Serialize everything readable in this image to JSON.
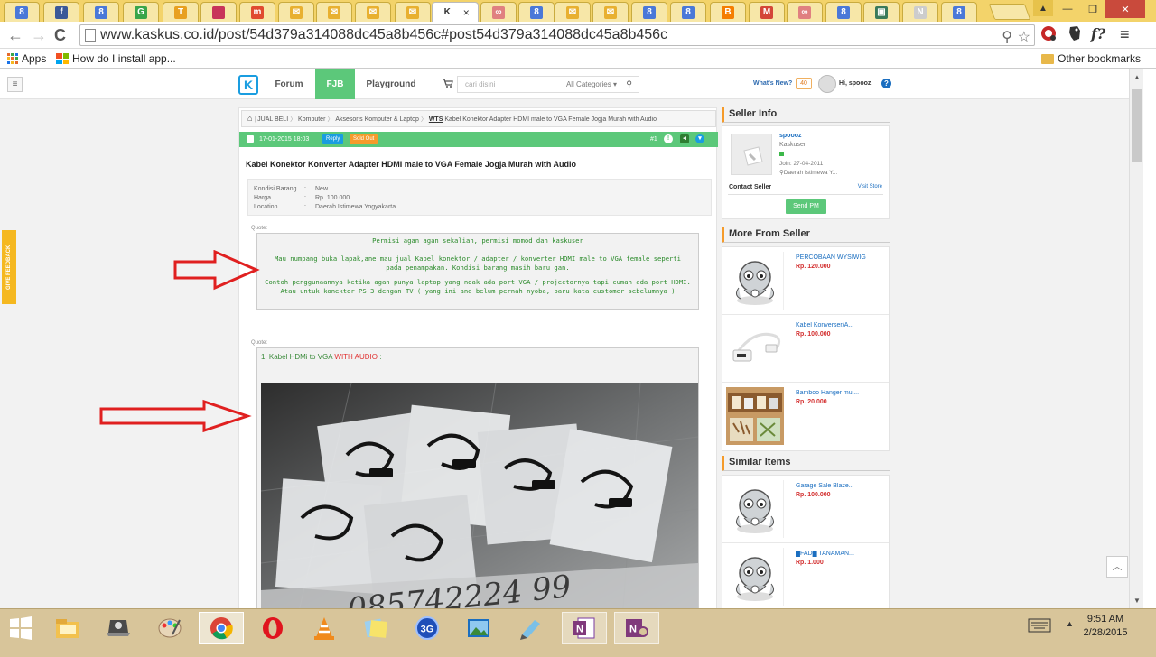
{
  "browser": {
    "tabs": [
      {
        "icon": "google-icon",
        "letter": "8",
        "color": "#4a78d8"
      },
      {
        "icon": "facebook-icon",
        "letter": "f",
        "color": "#3b5998"
      },
      {
        "icon": "google-icon",
        "letter": "8",
        "color": "#4a78d8"
      },
      {
        "icon": "g-green-icon",
        "letter": "G",
        "color": "#3aa54a"
      },
      {
        "icon": "t-icon",
        "letter": "T",
        "color": "#e8a020"
      },
      {
        "icon": "windows-icon",
        "letter": "",
        "color": "#c8345a"
      },
      {
        "icon": "m-icon",
        "letter": "m",
        "color": "#e04b30"
      },
      {
        "icon": "mail-icon",
        "letter": "✉",
        "color": "#e8b030"
      },
      {
        "icon": "mail-icon",
        "letter": "✉",
        "color": "#e8b030"
      },
      {
        "icon": "mail-icon",
        "letter": "✉",
        "color": "#e8b030"
      },
      {
        "icon": "mail-icon",
        "letter": "✉",
        "color": "#e8b030"
      },
      {
        "icon": "kaskus-icon",
        "letter": "K",
        "color": "#333333",
        "label": "K",
        "close": "×"
      },
      {
        "icon": "chain-icon",
        "letter": "∞",
        "color": "#e08080"
      },
      {
        "icon": "google-icon",
        "letter": "8",
        "color": "#4a78d8"
      },
      {
        "icon": "mail-icon",
        "letter": "✉",
        "color": "#e8b030"
      },
      {
        "icon": "mail-icon",
        "letter": "✉",
        "color": "#e8b030"
      },
      {
        "icon": "google-icon",
        "letter": "8",
        "color": "#4a78d8"
      },
      {
        "icon": "google-icon",
        "letter": "8",
        "color": "#4a78d8"
      },
      {
        "icon": "blogger-icon",
        "letter": "B",
        "color": "#f57d00"
      },
      {
        "icon": "gmail-icon",
        "letter": "M",
        "color": "#d44638"
      },
      {
        "icon": "chain-icon",
        "letter": "∞",
        "color": "#e08080"
      },
      {
        "icon": "google-icon",
        "letter": "8",
        "color": "#4a78d8"
      },
      {
        "icon": "landscape-icon",
        "letter": "▣",
        "color": "#3a7a5a"
      },
      {
        "icon": "n-icon",
        "letter": "N",
        "color": "#cccccc"
      },
      {
        "icon": "google-icon",
        "letter": "8",
        "color": "#4a78d8"
      }
    ],
    "url": "www.kaskus.co.id/post/54d379a314088dc45a8b456c#post54d379a314088dc45a8b456c",
    "bookmarks": {
      "apps": "Apps",
      "item1": "How do I install app...",
      "other": "Other bookmarks"
    }
  },
  "site": {
    "nav": {
      "forum": "Forum",
      "fjb": "FJB",
      "playground": "Playground"
    },
    "search": {
      "placeholder": "cari disini",
      "category": "All Categories",
      "cat_arrow": "▾"
    },
    "whats_new": "What's New?",
    "notif_count": "40",
    "greeting": "Hi, spoooz",
    "feedback": "GIVE FEEDBACK"
  },
  "breadcrumb": {
    "items": [
      "JUAL BELI",
      "Komputer",
      "Aksesoris Komputer & Laptop"
    ],
    "wts": "WTS",
    "current": "Kabel Konektor Adapter HDMI male to VGA Female Jogja Murah with Audio"
  },
  "post": {
    "date": "17-01-2015 18:03",
    "reply": "Reply",
    "sold_out": "Sold Out",
    "number": "#1",
    "title": "Kabel Konektor Konverter Adapter HDMI male to VGA Female Jogja Murah with Audio",
    "details": [
      {
        "key": "Kondisi Barang",
        "value": "New"
      },
      {
        "key": "Harga",
        "value": "Rp. 100.000"
      },
      {
        "key": "Location",
        "value": "Daerah Istimewa Yogyakarta"
      }
    ],
    "quote_label": "Quote:",
    "quote1": [
      "Permisi agan agan sekalian, permisi momod dan kaskuser",
      "Mau numpang buka lapak,ane mau jual Kabel konektor / adapter / konverter HDMI male to VGA female seperti pada penampakan. Kondisi barang masih baru gan.",
      "Contoh penggunaannya ketika agan punya laptop yang ndak ada port VGA / projectornya tapi cuman ada port HDMI. Atau untuk konektor PS 3 dengan TV ( yang ini ane belum pernah nyoba, baru kata customer sebelumnya )"
    ],
    "quote2_prefix": "1. Kabel HDMi to VGA",
    "quote2_red": "WITH AUDIO",
    "quote2_suffix": ":",
    "photo_handwriting": "085742224 99"
  },
  "sidebar": {
    "seller_info": "Seller Info",
    "seller": {
      "name": "spoooz",
      "role": "Kaskuser",
      "join": "Join: 27-04-2011",
      "location": "Daerah Istimewa Y...",
      "contact": "Contact Seller",
      "visit": "Visit Store",
      "send_pm": "Send PM"
    },
    "more_from_seller": "More From Seller",
    "more_items": [
      {
        "name": "PERCOBAAN WYSIWIG",
        "price": "Rp. 120.000",
        "thumb": "kaskus-mascot"
      },
      {
        "name": "Kabel Konverser/A...",
        "price": "Rp. 100.000",
        "thumb": "adapter-photo"
      },
      {
        "name": "Bamboo Hanger mul...",
        "price": "Rp. 20.000",
        "thumb": "bamboo-photo"
      }
    ],
    "similar_items": "Similar Items",
    "similar": [
      {
        "name": "Garage Sale Blaze...",
        "price": "Rp. 100.000",
        "thumb": "kaskus-mascot"
      },
      {
        "name": "█FAD█ TANAMAN...",
        "price": "Rp. 1.000",
        "thumb": "kaskus-mascot"
      }
    ]
  },
  "taskbar": {
    "apps": [
      {
        "name": "file-explorer-icon"
      },
      {
        "name": "laptop-icon"
      },
      {
        "name": "paint-icon"
      },
      {
        "name": "chrome-icon",
        "active": true
      },
      {
        "name": "opera-icon"
      },
      {
        "name": "vlc-icon"
      },
      {
        "name": "sticky-notes-icon"
      },
      {
        "name": "3g-modem-icon"
      },
      {
        "name": "photo-viewer-icon"
      },
      {
        "name": "notepad-icon"
      },
      {
        "name": "onenote-icon",
        "running": true
      },
      {
        "name": "onenote-2-icon",
        "running": true
      }
    ],
    "time": "9:51 AM",
    "date": "2/28/2015"
  },
  "colors": {
    "fjb_green": "#5cc87a",
    "kaskus_blue": "#1a9de0",
    "price_red": "#d32f2f",
    "annotation_red": "#e02020"
  }
}
